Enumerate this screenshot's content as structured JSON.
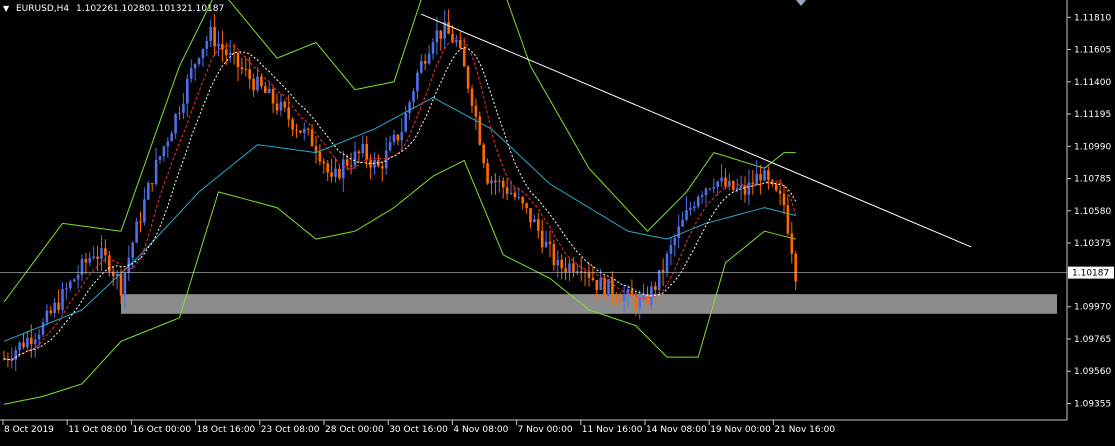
{
  "chart_data": {
    "type": "candlestick",
    "symbol_line": {
      "symbol": "EURUSD,H4",
      "open": "1.10226",
      "high": "1.10280",
      "low": "1.10132",
      "close": "1.10187"
    },
    "ylim": [
      1.0925,
      1.1192
    ],
    "y_ticks": [
      "1.11810",
      "1.11605",
      "1.11400",
      "1.11195",
      "1.10990",
      "1.10785",
      "1.10580",
      "1.10375",
      "1.10187",
      "1.09970",
      "1.09765",
      "1.09560",
      "1.09355"
    ],
    "current_price": 1.10187,
    "current_price_label": "1.10187",
    "x_ticks": [
      "8 Oct 2019",
      "11 Oct 08:00",
      "16 Oct 00:00",
      "18 Oct 16:00",
      "23 Oct 08:00",
      "28 Oct 00:00",
      "30 Oct 16:00",
      "4 Nov 08:00",
      "7 Nov 00:00",
      "11 Nov 16:00",
      "14 Nov 08:00",
      "19 Nov 00:00",
      "21 Nov 16:00"
    ],
    "path_waypoints": [
      [
        0,
        1.0964
      ],
      [
        10,
        1.0985
      ],
      [
        18,
        1.1015
      ],
      [
        23,
        1.1032
      ],
      [
        27,
        1.1025
      ],
      [
        30,
        1.101
      ],
      [
        33,
        1.1038
      ],
      [
        38,
        1.108
      ],
      [
        44,
        1.1118
      ],
      [
        50,
        1.116
      ],
      [
        53,
        1.117
      ],
      [
        58,
        1.1155
      ],
      [
        64,
        1.114
      ],
      [
        70,
        1.1125
      ],
      [
        75,
        1.1112
      ],
      [
        80,
        1.11
      ],
      [
        82,
        1.109
      ],
      [
        84,
        1.1075
      ],
      [
        87,
        1.1088
      ],
      [
        92,
        1.1095
      ],
      [
        96,
        1.1085
      ],
      [
        102,
        1.111
      ],
      [
        106,
        1.1145
      ],
      [
        110,
        1.117
      ],
      [
        113,
        1.1172
      ],
      [
        116,
        1.1165
      ],
      [
        120,
        1.113
      ],
      [
        124,
        1.108
      ],
      [
        130,
        1.107
      ],
      [
        136,
        1.105
      ],
      [
        142,
        1.1022
      ],
      [
        148,
        1.1025
      ],
      [
        152,
        1.1012
      ],
      [
        158,
        1.1005
      ],
      [
        164,
        1.0998
      ],
      [
        168,
        1.1015
      ],
      [
        172,
        1.104
      ],
      [
        178,
        1.107
      ],
      [
        182,
        1.1078
      ],
      [
        186,
        1.1072
      ],
      [
        190,
        1.107
      ],
      [
        194,
        1.1082
      ],
      [
        197,
        1.107
      ],
      [
        200,
        1.1062
      ],
      [
        202,
        1.1035
      ],
      [
        203,
        1.1019
      ]
    ],
    "upper_band_waypoints": [
      [
        0,
        1.1
      ],
      [
        15,
        1.105
      ],
      [
        30,
        1.1045
      ],
      [
        45,
        1.115
      ],
      [
        55,
        1.12
      ],
      [
        70,
        1.1155
      ],
      [
        80,
        1.1165
      ],
      [
        90,
        1.1135
      ],
      [
        100,
        1.114
      ],
      [
        112,
        1.123
      ],
      [
        125,
        1.122
      ],
      [
        135,
        1.115
      ],
      [
        150,
        1.1085
      ],
      [
        165,
        1.1045
      ],
      [
        175,
        1.107
      ],
      [
        182,
        1.1095
      ],
      [
        195,
        1.1085
      ],
      [
        200,
        1.1095
      ]
    ],
    "lower_band_waypoints": [
      [
        0,
        1.0935
      ],
      [
        10,
        1.094
      ],
      [
        20,
        1.0948
      ],
      [
        30,
        1.0975
      ],
      [
        45,
        1.099
      ],
      [
        55,
        1.107
      ],
      [
        70,
        1.106
      ],
      [
        80,
        1.104
      ],
      [
        90,
        1.1045
      ],
      [
        100,
        1.106
      ],
      [
        110,
        1.108
      ],
      [
        118,
        1.109
      ],
      [
        128,
        1.103
      ],
      [
        140,
        1.1015
      ],
      [
        150,
        1.0995
      ],
      [
        162,
        1.0985
      ],
      [
        170,
        1.0965
      ],
      [
        178,
        1.0965
      ],
      [
        185,
        1.1025
      ],
      [
        195,
        1.1045
      ],
      [
        203,
        1.104
      ]
    ],
    "slow_ma_waypoints": [
      [
        0,
        1.0975
      ],
      [
        20,
        1.0995
      ],
      [
        35,
        1.103
      ],
      [
        50,
        1.107
      ],
      [
        65,
        1.11
      ],
      [
        80,
        1.1095
      ],
      [
        95,
        1.111
      ],
      [
        110,
        1.113
      ],
      [
        125,
        1.111
      ],
      [
        140,
        1.1075
      ],
      [
        160,
        1.1045
      ],
      [
        170,
        1.104
      ],
      [
        180,
        1.105
      ],
      [
        195,
        1.106
      ],
      [
        203,
        1.1055
      ]
    ],
    "trendline": {
      "start": [
        107,
        1.1183
      ],
      "end": [
        248,
        1.1035
      ]
    },
    "support_zone": {
      "from_index": 30,
      "to_index": 270,
      "top": 1.1005,
      "bottom": 1.09925
    },
    "colors": {
      "background": "#000000",
      "bull_candle": "#4f6fe6",
      "bear_candle": "#ff6a00",
      "upper_band": "#7ee02b",
      "lower_band": "#7ee02b",
      "slow_ma": "#2aa7c9",
      "fast_ma": "#ff2b2b",
      "signal_ma": "#ffffff",
      "trendline": "#ffffff",
      "support_zone": "#8c8c8c",
      "price_line": "#c0c0c0",
      "axis_text": "#ffffff"
    }
  }
}
